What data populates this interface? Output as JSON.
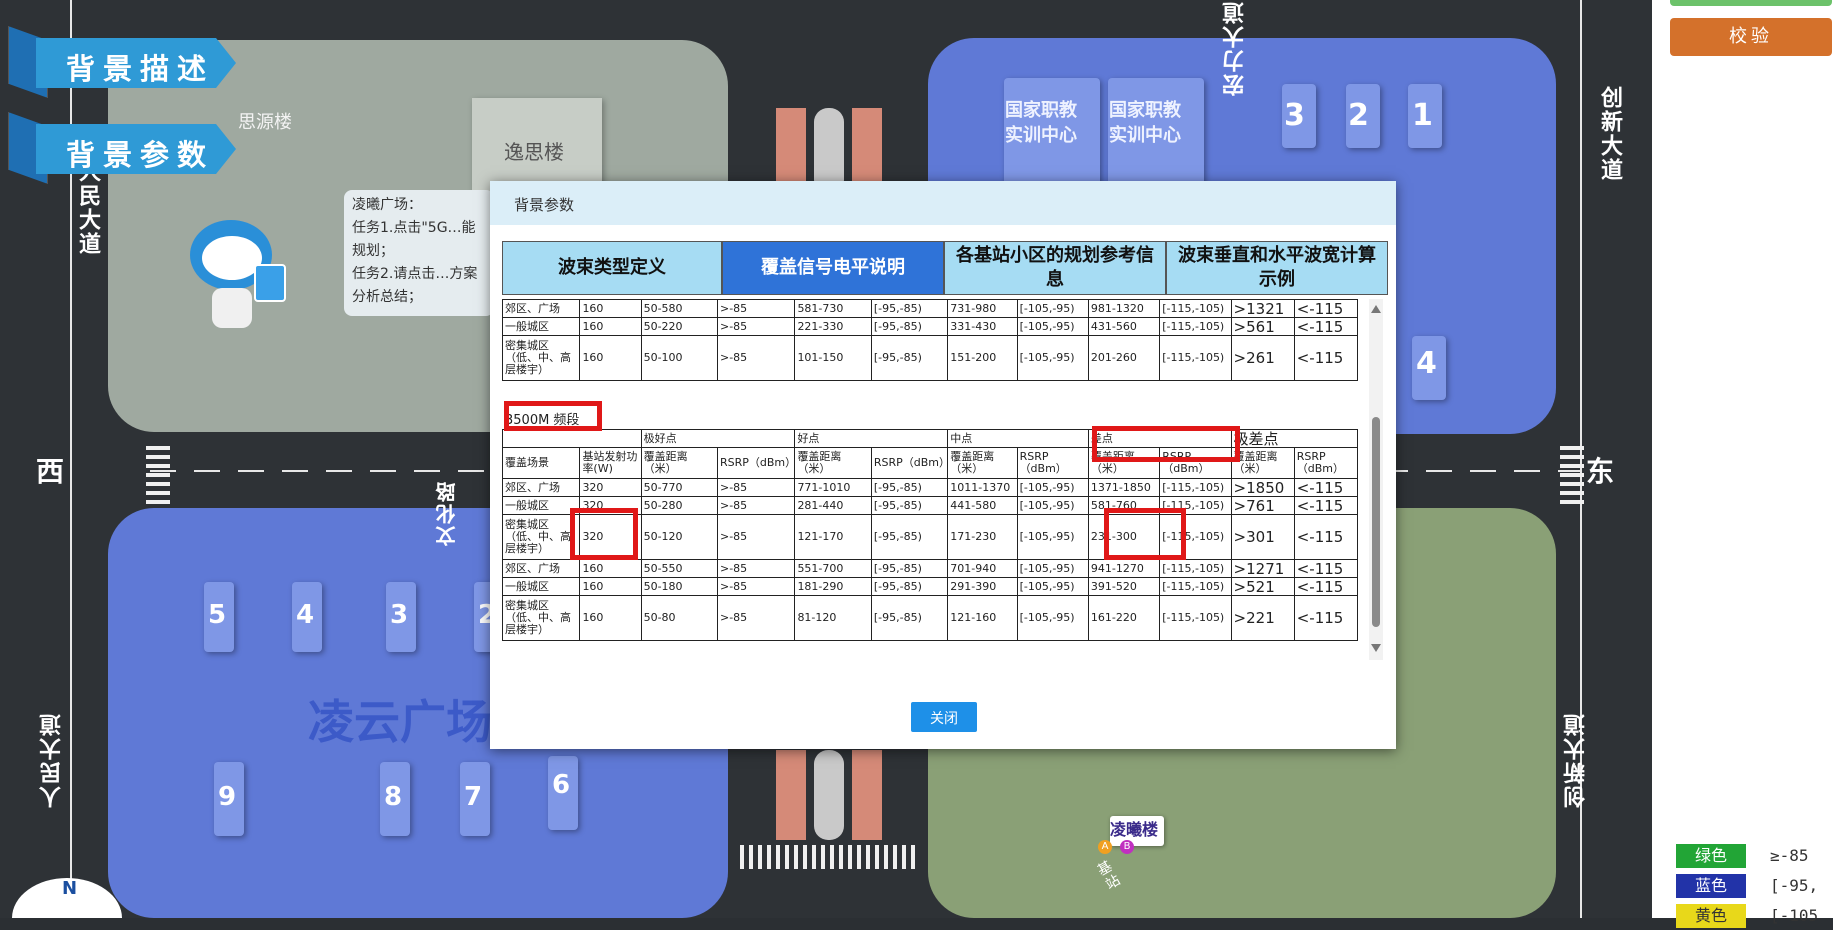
{
  "map": {
    "roads": {
      "north_right": "宏力大道",
      "east_top": "创新大道",
      "west_top": "人民大道",
      "west_bottom": "人民大道",
      "east_bottom": "创新大道",
      "center": "文化路",
      "west": "西",
      "east": "东",
      "compass": "N"
    },
    "buildings": {
      "siyuan": "思源楼",
      "yisi": "逸思楼",
      "center1": "国家职教实训中心",
      "center2": "国家职教实训中心",
      "lingyun": "凌云广场",
      "lingxi": "凌曦楼",
      "base_station": "基站",
      "markers": [
        "A",
        "B"
      ],
      "tr_numbers": [
        "3",
        "2",
        "1",
        "4"
      ],
      "bl_numbers": [
        "5",
        "4",
        "3",
        "2",
        "9",
        "8",
        "7",
        "6"
      ]
    },
    "speech": "凌曦广场：\n任务1.点击\"5G…能规划；\n任务2.请点击…方案分析总结；"
  },
  "banners": {
    "desc": "背景描述",
    "params": "背景参数"
  },
  "right_panel": {
    "verify_label": "校验",
    "legend": [
      {
        "name": "绿色",
        "range": "≥-85",
        "color": "#22a536"
      },
      {
        "name": "蓝色",
        "range": "[-95,",
        "color": "#2233a8"
      },
      {
        "name": "黄色",
        "range": "[-105",
        "color": "#e8d81a"
      }
    ]
  },
  "modal": {
    "title": "背景参数",
    "close_label": "关闭",
    "tabs": [
      {
        "label": "波束类型定义",
        "active": false
      },
      {
        "label": "覆盖信号电平说明",
        "active": true
      },
      {
        "label": "各基站小区的规划参考信息",
        "active": false
      },
      {
        "label": "波束垂直和水平波宽计算示例",
        "active": false
      }
    ],
    "top_rows": [
      [
        "郊区、广场",
        "160",
        "50-580",
        ">-85",
        "581-730",
        "[-95,-85)",
        "731-980",
        "[-105,-95)",
        "981-1320",
        "[-115,-105)",
        ">1321",
        "<-115"
      ],
      [
        "一般城区",
        "160",
        "50-220",
        ">-85",
        "221-330",
        "[-95,-85)",
        "331-430",
        "[-105,-95)",
        "431-560",
        "[-115,-105)",
        ">561",
        "<-115"
      ],
      [
        "密集城区（低、中、高层楼宇）",
        "160",
        "50-100",
        ">-85",
        "101-150",
        "[-95,-85)",
        "151-200",
        "[-105,-95)",
        "201-260",
        "[-115,-105)",
        ">261",
        "<-115"
      ]
    ],
    "band_label": "3500M 频段",
    "level_headers": [
      "极好点",
      "好点",
      "中点",
      "差点",
      "极差点"
    ],
    "col_headers": [
      "覆盖场景",
      "基站发射功率(W)",
      "覆盖距离（米）",
      "RSRP（dBm）",
      "覆盖距离（米）",
      "RSRP（dBm）",
      "覆盖距离（米）",
      "RSRP（dBm）",
      "覆盖距离（米）",
      "RSRP（dBm）",
      "覆盖距离（米）",
      "RSRP（dBm）"
    ],
    "band_rows": [
      [
        "郊区、广场",
        "320",
        "50-770",
        ">-85",
        "771-1010",
        "[-95,-85)",
        "1011-1370",
        "[-105,-95)",
        "1371-1850",
        "[-115,-105)",
        ">1850",
        "<-115"
      ],
      [
        "一般城区",
        "320",
        "50-280",
        ">-85",
        "281-440",
        "[-95,-85)",
        "441-580",
        "[-105,-95)",
        "581-760",
        "[-115,-105)",
        ">761",
        "<-115"
      ],
      [
        "密集城区（低、中、高层楼宇）",
        "320",
        "50-120",
        ">-85",
        "121-170",
        "[-95,-85)",
        "171-230",
        "[-105,-95)",
        "231-300",
        "[-115,-105)",
        ">301",
        "<-115"
      ],
      [
        "郊区、广场",
        "160",
        "50-550",
        ">-85",
        "551-700",
        "[-95,-85)",
        "701-940",
        "[-105,-95)",
        "941-1270",
        "[-115,-105)",
        ">1271",
        "<-115"
      ],
      [
        "一般城区",
        "160",
        "50-180",
        ">-85",
        "181-290",
        "[-95,-85)",
        "291-390",
        "[-105,-95)",
        "391-520",
        "[-115,-105)",
        ">521",
        "<-115"
      ],
      [
        "密集城区（低、中、高层楼宇）",
        "160",
        "50-80",
        ">-85",
        "81-120",
        "[-95,-85)",
        "121-160",
        "[-105,-95)",
        "161-220",
        "[-115,-105)",
        ">221",
        "<-115"
      ]
    ]
  }
}
